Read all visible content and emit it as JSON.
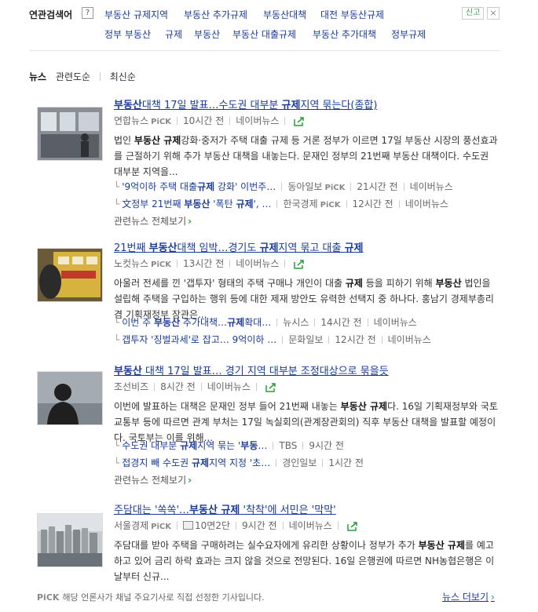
{
  "related": {
    "label": "연관검색어",
    "help": "?",
    "report": "신고",
    "close": "×",
    "row1": [
      "부동산 규제지역",
      "부동산 추가규제",
      "부동산대책",
      "대전 부동산규제"
    ],
    "row2": [
      "정부 부동산",
      "규제",
      "부동산",
      "부동산 대출규제",
      "부동산 추가대책",
      "정부규제"
    ]
  },
  "tabs": [
    "뉴스",
    "관련도순",
    "최신순"
  ],
  "pick_label": "PiCK",
  "news": [
    {
      "title_parts": [
        {
          "t": "부동산",
          "b": true
        },
        {
          "t": "대책 17일 발표…수도권 대부분 ",
          "b": false
        },
        {
          "t": "규제",
          "b": true
        },
        {
          "t": "지역 묶는다(종합)",
          "b": false
        }
      ],
      "press": "연합뉴스",
      "time": "10시간 전",
      "portal": "네이버뉴스",
      "desc_parts": [
        {
          "t": "법인 ",
          "b": false
        },
        {
          "t": "부동산 규제",
          "b": true
        },
        {
          "t": "강화·중저가 주택 대출 규제 등 거론 정부가 이르면 17일 부동산 시장의 풍선효과를 근절하기 위해 추가 부동산 대책을 내놓는다. 문재인 정부의 21번째 부동산 대책이다. 수도권 대부분 지역을...",
          "b": false
        }
      ],
      "subs": [
        {
          "parts": [
            {
              "t": "'9억이하 주택 대출",
              "b": false
            },
            {
              "t": "규제",
              "b": true
            },
            {
              "t": " 강화' 이번주…",
              "b": false
            }
          ],
          "press": "동아일보",
          "pick": true,
          "time": "21시간 전",
          "portal": "네이버뉴스"
        },
        {
          "parts": [
            {
              "t": "文정부 21번째 ",
              "b": false
            },
            {
              "t": "부동산",
              "b": true
            },
            {
              "t": " '폭탄 ",
              "b": false
            },
            {
              "t": "규제",
              "b": true
            },
            {
              "t": "', …",
              "b": false
            }
          ],
          "press": "한국경제",
          "pick": true,
          "time": "12시간 전",
          "portal": "네이버뉴스"
        }
      ],
      "more": "관련뉴스 전체보기"
    },
    {
      "title_parts": [
        {
          "t": "21번째 ",
          "b": false
        },
        {
          "t": "부동산",
          "b": true
        },
        {
          "t": "대책 임박…경기도 ",
          "b": false
        },
        {
          "t": "규제",
          "b": true
        },
        {
          "t": "지역 묶고 대출 ",
          "b": false
        },
        {
          "t": "규제",
          "b": true
        }
      ],
      "press": "노컷뉴스",
      "time": "13시간 전",
      "portal": "네이버뉴스",
      "desc_parts": [
        {
          "t": "아울러 전세를 낀 '갭투자' 형태의 주택 구매나 개인이 대출 ",
          "b": false
        },
        {
          "t": "규제",
          "b": true
        },
        {
          "t": " 등을 피하기 위해 ",
          "b": false
        },
        {
          "t": "부동산",
          "b": true
        },
        {
          "t": " 법인을 설립해 주택을 구입하는 행위 등에 대한 제재 방안도 유력한 선택지 중 하나다. 홍남기 경제부총리 겸 기획재정부 장관은...",
          "b": false
        }
      ],
      "subs": [
        {
          "parts": [
            {
              "t": "이번 주 ",
              "b": false
            },
            {
              "t": "부동산",
              "b": true
            },
            {
              "t": " 추가대책…",
              "b": false
            },
            {
              "t": "규제",
              "b": true
            },
            {
              "t": "확대…",
              "b": false
            }
          ],
          "press": "뉴시스",
          "pick": false,
          "time": "14시간 전",
          "portal": "네이버뉴스"
        },
        {
          "parts": [
            {
              "t": "갭투자 '징벌과세'로 잡고… 9억이하 …",
              "b": false
            }
          ],
          "press": "문화일보",
          "pick": false,
          "time": "12시간 전",
          "portal": "네이버뉴스"
        }
      ],
      "more": ""
    },
    {
      "title_parts": [
        {
          "t": "부동산",
          "b": true
        },
        {
          "t": " 대책 17일 발표… 경기 지역 대부분 조정대상으로 묶을듯",
          "b": false
        }
      ],
      "press": "조선비즈",
      "time": "8시간 전",
      "portal": "네이버뉴스",
      "desc_parts": [
        {
          "t": "이번에 발표하는 대책은 문재인 정부 들어 21번째 내놓는 ",
          "b": false
        },
        {
          "t": "부동산 규제",
          "b": true
        },
        {
          "t": "다. 16일 기획재정부와 국토교통부 등에 따르면 관계 부처는 17일 녹실회의(관계장관회의) 직후 부동산 대책을 발표할 예정이다. 국토부는 이를 위해...",
          "b": false
        }
      ],
      "subs": [
        {
          "parts": [
            {
              "t": "수도권 대부분 ",
              "b": false
            },
            {
              "t": "규제",
              "b": true
            },
            {
              "t": "지역 묶는 '",
              "b": false
            },
            {
              "t": "부동",
              "b": true
            },
            {
              "t": "…",
              "b": false
            }
          ],
          "press": "TBS",
          "pick": false,
          "time": "9시간 전",
          "portal": ""
        },
        {
          "parts": [
            {
              "t": "접경지 빼 수도권 ",
              "b": false
            },
            {
              "t": "규제",
              "b": true
            },
            {
              "t": "지역 지정 '초…",
              "b": false
            }
          ],
          "press": "경인일보",
          "pick": false,
          "time": "1시간 전",
          "portal": ""
        }
      ],
      "more": "관련뉴스 전체보기"
    },
    {
      "title_parts": [
        {
          "t": "주담대는 '쏙쏙'…",
          "b": false
        },
        {
          "t": "부동산 규제",
          "b": true
        },
        {
          "t": " '착착'에 서민은 '막막'",
          "b": false
        }
      ],
      "press": "서울경제",
      "paper": "10면2단",
      "time": "9시간 전",
      "portal": "네이버뉴스",
      "desc_parts": [
        {
          "t": "주담대를 받아 주택을 구매하려는 실수요자에게 유리한 상황이나 정부가 추가 ",
          "b": false
        },
        {
          "t": "부동산 규제",
          "b": true
        },
        {
          "t": "를 예고하고 있어 금리 하락 효과는 크지 않을 것으로 전망된다. 16일 은행권에 따르면 NH농협은행은 이날부터 신규...",
          "b": false
        }
      ],
      "subs": [],
      "more": ""
    }
  ],
  "footer": {
    "note": "해당 언론사가 채널 주요기사로 직접 선정한 기사입니다.",
    "more": "뉴스 더보기"
  }
}
